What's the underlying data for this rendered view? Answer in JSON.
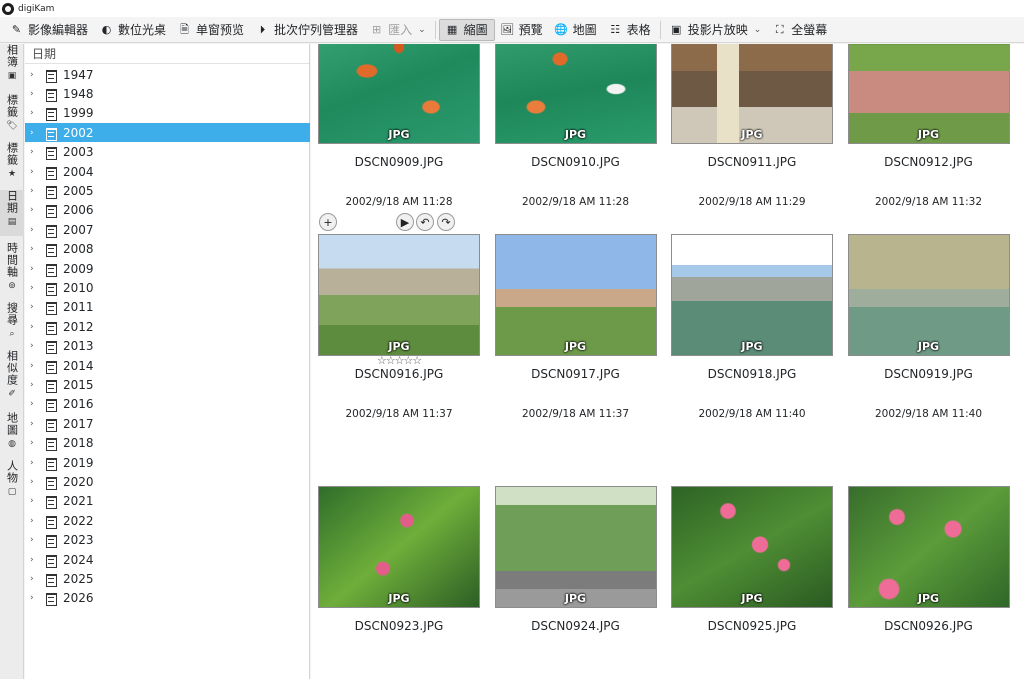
{
  "window": {
    "title": "digiKam"
  },
  "toolbar": {
    "items": [
      {
        "label": "影像編輯器",
        "icon": "pencil-icon"
      },
      {
        "label": "數位光桌",
        "icon": "lighttable-icon"
      },
      {
        "label": "单窗预览",
        "icon": "single-preview-icon"
      },
      {
        "label": "批次佇列管理器",
        "icon": "batch-queue-icon"
      },
      {
        "label": "匯入",
        "icon": "import-icon"
      },
      {
        "label": "縮圖",
        "icon": "thumbnails-icon"
      },
      {
        "label": "預覽",
        "icon": "preview-icon"
      },
      {
        "label": "地圖",
        "icon": "globe-icon"
      },
      {
        "label": "表格",
        "icon": "table-icon"
      },
      {
        "label": "投影片放映",
        "icon": "slideshow-icon"
      },
      {
        "label": "全螢幕",
        "icon": "fullscreen-icon"
      }
    ],
    "active": "縮圖",
    "disabled": "匯入"
  },
  "left_tabs": [
    {
      "label": "相簿",
      "icon": "album-icon"
    },
    {
      "label": "標籤",
      "icon": "tag-icon"
    },
    {
      "label": "標籤",
      "icon": "star-icon"
    },
    {
      "label": "日期",
      "icon": "calendar-icon"
    },
    {
      "label": "時間軸",
      "icon": "timeline-icon"
    },
    {
      "label": "搜尋",
      "icon": "search-icon"
    },
    {
      "label": "相似度",
      "icon": "fuzzy-search-icon"
    },
    {
      "label": "地圖",
      "icon": "globe-icon"
    },
    {
      "label": "人物",
      "icon": "people-icon"
    }
  ],
  "date_tree": {
    "header": "日期",
    "selected": "2002",
    "years": [
      "1947",
      "1948",
      "1999",
      "2002",
      "2003",
      "2004",
      "2005",
      "2006",
      "2007",
      "2008",
      "2009",
      "2010",
      "2011",
      "2012",
      "2013",
      "2014",
      "2015",
      "2016",
      "2017",
      "2018",
      "2019",
      "2020",
      "2021",
      "2022",
      "2023",
      "2024",
      "2025",
      "2026"
    ]
  },
  "thumbnails": [
    {
      "name": "DSCN0909.JPG",
      "date": "2002/9/18 AM 11:28",
      "format": "JPG"
    },
    {
      "name": "DSCN0910.JPG",
      "date": "2002/9/18 AM 11:28",
      "format": "JPG"
    },
    {
      "name": "DSCN0911.JPG",
      "date": "2002/9/18 AM 11:29",
      "format": "JPG"
    },
    {
      "name": "DSCN0912.JPG",
      "date": "2002/9/18 AM 11:32",
      "format": "JPG"
    },
    {
      "name": "DSCN0916.JPG",
      "date": "2002/9/18 AM 11:37",
      "format": "JPG",
      "rating": "☆☆☆☆☆"
    },
    {
      "name": "DSCN0917.JPG",
      "date": "2002/9/18 AM 11:37",
      "format": "JPG"
    },
    {
      "name": "DSCN0918.JPG",
      "date": "2002/9/18 AM 11:40",
      "format": "JPG"
    },
    {
      "name": "DSCN0919.JPG",
      "date": "2002/9/18 AM 11:40",
      "format": "JPG"
    },
    {
      "name": "DSCN0923.JPG",
      "date": "",
      "format": "JPG"
    },
    {
      "name": "DSCN0924.JPG",
      "date": "",
      "format": "JPG"
    },
    {
      "name": "DSCN0925.JPG",
      "date": "",
      "format": "JPG"
    },
    {
      "name": "DSCN0926.JPG",
      "date": "",
      "format": "JPG"
    }
  ],
  "hover_overlay": {
    "add": "+",
    "play": "▶"
  },
  "colors": {
    "selection": "#3daee9",
    "background": "#f4f4f4"
  }
}
